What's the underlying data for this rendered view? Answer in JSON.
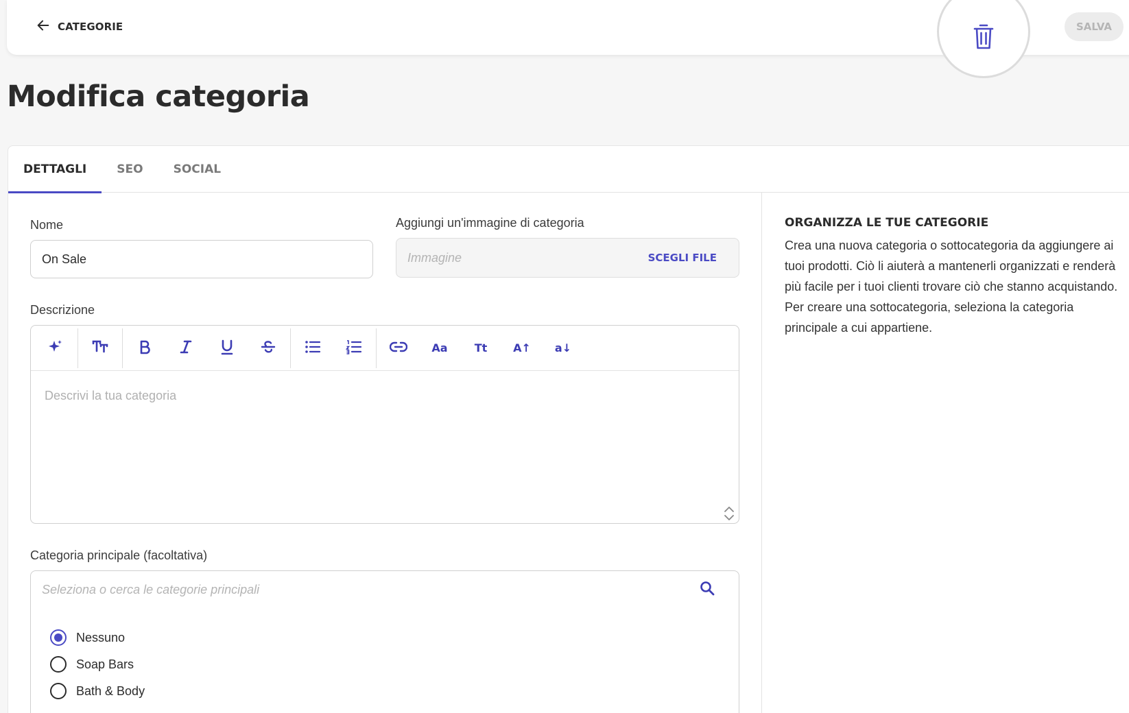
{
  "header": {
    "back_label": "CATEGORIE",
    "save_label": "SALVA"
  },
  "page_title": "Modifica categoria",
  "tabs": [
    {
      "label": "DETTAGLI",
      "active": true
    },
    {
      "label": "SEO",
      "active": false
    },
    {
      "label": "SOCIAL",
      "active": false
    }
  ],
  "form": {
    "name_label": "Nome",
    "name_value": "On Sale",
    "image_label": "Aggiungi un'immagine di categoria",
    "image_placeholder": "Immagine",
    "choose_file_label": "SCEGLI FILE",
    "description_label": "Descrizione",
    "description_placeholder": "Descrivi la tua categoria",
    "toolbar_text_buttons": {
      "case": "Aa",
      "title_case": "Tt",
      "increase": "A↑",
      "decrease": "a↓"
    },
    "parent_label": "Categoria principale (facoltativa)",
    "parent_placeholder": "Seleziona o cerca le categorie principali",
    "parent_options": [
      {
        "label": "Nessuno",
        "checked": true
      },
      {
        "label": "Soap Bars",
        "checked": false
      },
      {
        "label": "Bath & Body",
        "checked": false
      }
    ]
  },
  "help": {
    "title": "ORGANIZZA LE TUE CATEGORIE",
    "text": "Crea una nuova categoria o sottocategoria da aggiungere ai tuoi prodotti. Ciò li aiuterà a mantenerli organizzati e renderà più facile per i tuoi clienti trovare ciò che stanno acquistando. Per creare una sottocategoria, seleziona la categoria principale a cui appartiene."
  },
  "colors": {
    "accent": "#4a4ac4",
    "background": "#f6f6f6",
    "save_disabled_bg": "#ececec"
  }
}
